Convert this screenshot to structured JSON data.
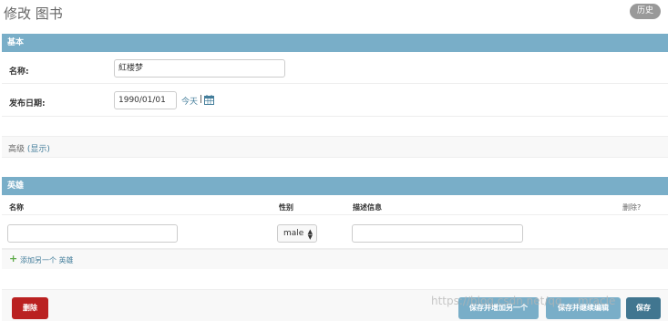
{
  "page": {
    "title": "修改 图书",
    "history_label": "历史"
  },
  "basic": {
    "header": "基本",
    "name_label": "名称:",
    "name_value": "紅楼梦",
    "date_label": "发布日期:",
    "date_value": "1990/01/01",
    "today_label": "今天",
    "separator": "|",
    "calendar_icon": "calendar-icon"
  },
  "advanced": {
    "label": "高级",
    "open_paren": "(",
    "show_label": "显示",
    "close_paren": ")"
  },
  "heroes": {
    "header": "英雄",
    "columns": [
      "名称",
      "性别",
      "描述信息",
      "删除?"
    ],
    "row": {
      "name_value": "",
      "gender_value": "male",
      "description_value": ""
    },
    "add_label": "添加另一个 英雄",
    "add_icon": "plus-icon"
  },
  "actions": {
    "delete_label": "删除",
    "save_add_another_label": "保存并增加另一个",
    "save_continue_label": "保存并继续编辑",
    "save_label": "保存"
  },
  "watermark": "https://blog.csdn.net/qq_...mracle",
  "colors": {
    "module_header": "#79aec8",
    "link": "#447e9b",
    "delete": "#ba2121",
    "save": "#417690",
    "add_icon": "#5eaa49"
  }
}
